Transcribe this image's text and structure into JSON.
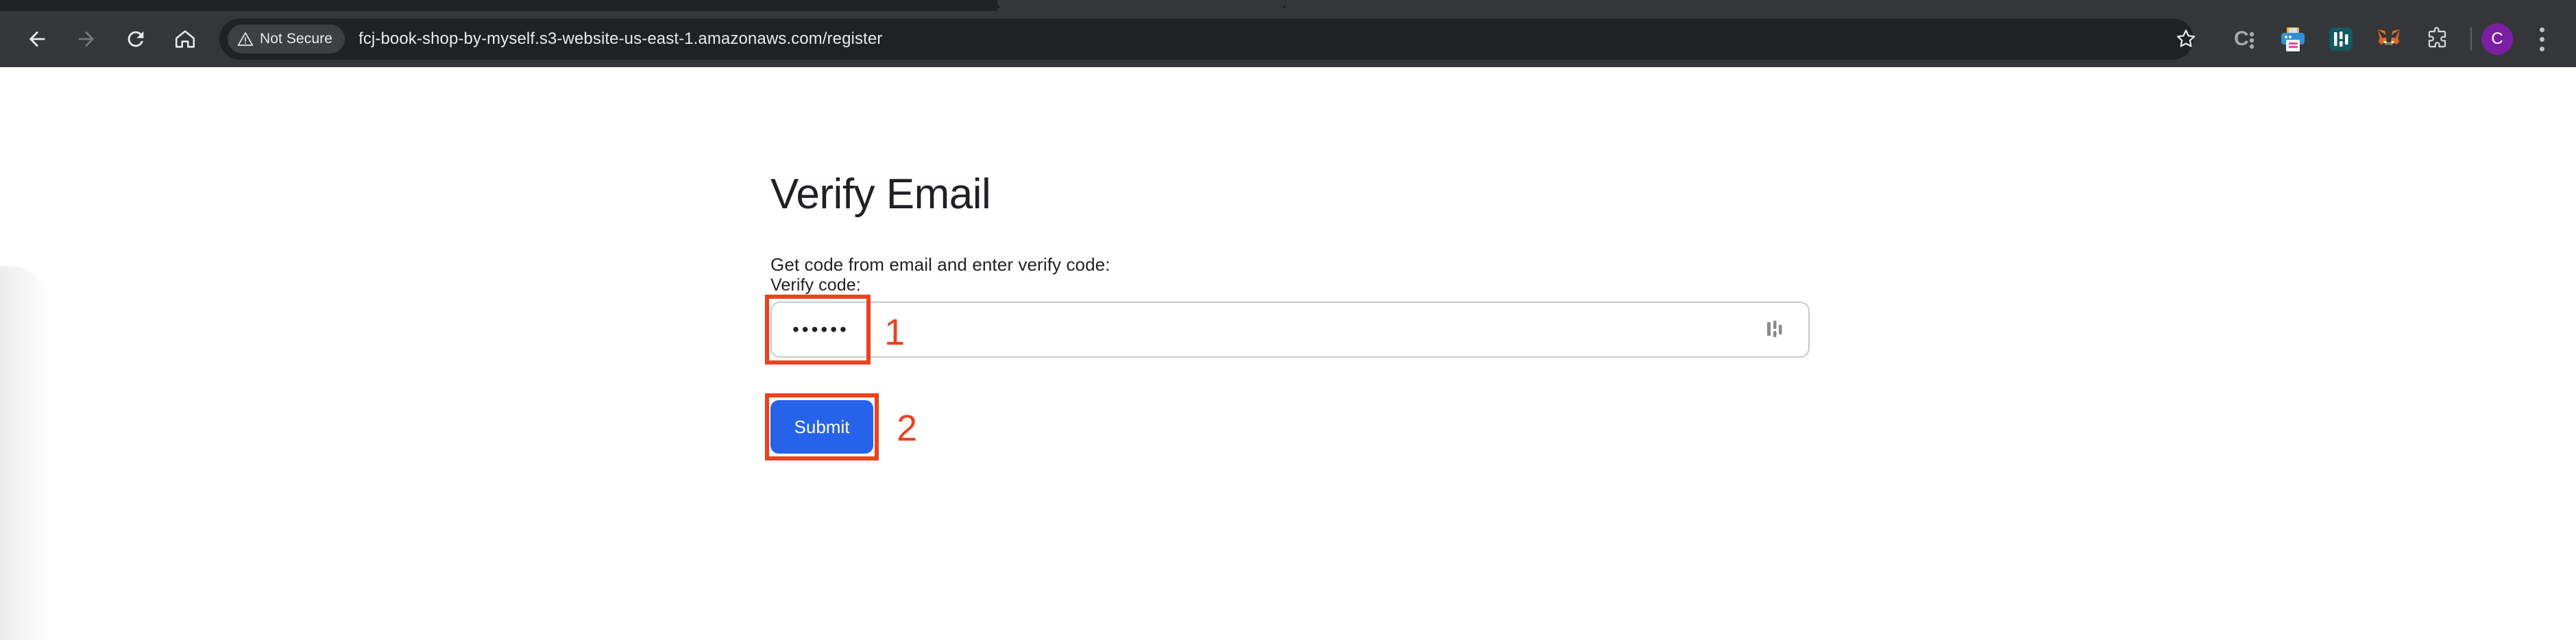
{
  "browser": {
    "nav": {
      "back_label": "Back",
      "forward_label": "Forward",
      "reload_label": "Reload",
      "home_label": "Home"
    },
    "omnibox": {
      "security_label": "Not Secure",
      "security_icon": "warning-triangle-icon",
      "url": "fcj-book-shop-by-myself.s3-website-us-east-1.amazonaws.com/register"
    },
    "toolbar_right": {
      "bookmark_icon": "star-icon",
      "items": [
        {
          "name": "c-colon-extension-icon",
          "label": "C:"
        },
        {
          "name": "printer-extension-icon",
          "label": "Printer"
        },
        {
          "name": "teal-bars-extension-icon",
          "label": "N"
        },
        {
          "name": "metamask-extension-icon",
          "label": "MetaMask"
        },
        {
          "name": "extensions-puzzle-icon",
          "label": "Extensions"
        }
      ],
      "profile_initial": "C",
      "menu_icon": "three-dot-menu-icon"
    }
  },
  "page": {
    "title": "Verify Email",
    "subtitle": "Get code from email and enter verify code:",
    "form": {
      "field_label": "Verify code:",
      "input_value": "••••••",
      "input_placeholder": "",
      "autofill_icon": "password-manager-icon",
      "submit_label": "Submit"
    }
  },
  "annotations": {
    "accent_color": "#f0411f",
    "marks": [
      {
        "id": "1",
        "label": "1",
        "target": "verify-code-input"
      },
      {
        "id": "2",
        "label": "2",
        "target": "submit-button"
      }
    ]
  },
  "colors": {
    "chrome_bg": "#35363a",
    "chrome_dark": "#202124",
    "submit_blue": "#2563eb",
    "annotation_red": "#f0411f",
    "avatar_purple": "#7b1fa2"
  }
}
